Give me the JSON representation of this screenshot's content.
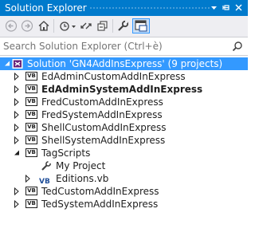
{
  "window": {
    "title": "Solution Explorer",
    "title_bar_color": "#007acc"
  },
  "toolbar": {
    "buttons": [
      {
        "name": "back-icon"
      },
      {
        "name": "forward-icon"
      },
      {
        "name": "home-icon"
      },
      {
        "name": "pending-changes-filter-icon"
      },
      {
        "name": "sync-icon"
      },
      {
        "name": "collapse-all-icon"
      },
      {
        "name": "properties-icon"
      },
      {
        "name": "preview-selected-items-icon"
      }
    ]
  },
  "search": {
    "placeholder": "Search Solution Explorer (Ctrl+è)"
  },
  "tree": {
    "selected_color": "#3399ff",
    "items": [
      {
        "label": "Solution 'GN4AddInsExpress' (9 projects)",
        "icon": "solution-icon",
        "expanded": true,
        "selected": true,
        "bold": false
      },
      {
        "label": "EdAdminCustomAddInExpress",
        "icon": "vb-project-icon",
        "expanded": false,
        "bold": false
      },
      {
        "label": "EdAdminSystemAddInExpress",
        "icon": "vb-project-icon",
        "expanded": false,
        "bold": true
      },
      {
        "label": "FredCustomAddInExpress",
        "icon": "vb-project-icon",
        "expanded": false,
        "bold": false
      },
      {
        "label": "FredSystemAddInExpress",
        "icon": "vb-project-icon",
        "expanded": false,
        "bold": false
      },
      {
        "label": "ShellCustomAddInExpress",
        "icon": "vb-project-icon",
        "expanded": false,
        "bold": false
      },
      {
        "label": "ShellSystemAddInExpress",
        "icon": "vb-project-icon",
        "expanded": false,
        "bold": false
      },
      {
        "label": "TagScripts",
        "icon": "vb-project-icon",
        "expanded": true,
        "bold": false
      },
      {
        "label": "My Project",
        "icon": "wrench-icon",
        "expanded": null,
        "bold": false
      },
      {
        "label": "Editions.vb",
        "icon": "vb-file-icon",
        "expanded": false,
        "bold": false
      },
      {
        "label": "TedCustomAddInExpress",
        "icon": "vb-project-icon",
        "expanded": false,
        "bold": false
      },
      {
        "label": "TedSystemAddInExpress",
        "icon": "vb-project-icon",
        "expanded": false,
        "bold": false
      }
    ]
  }
}
